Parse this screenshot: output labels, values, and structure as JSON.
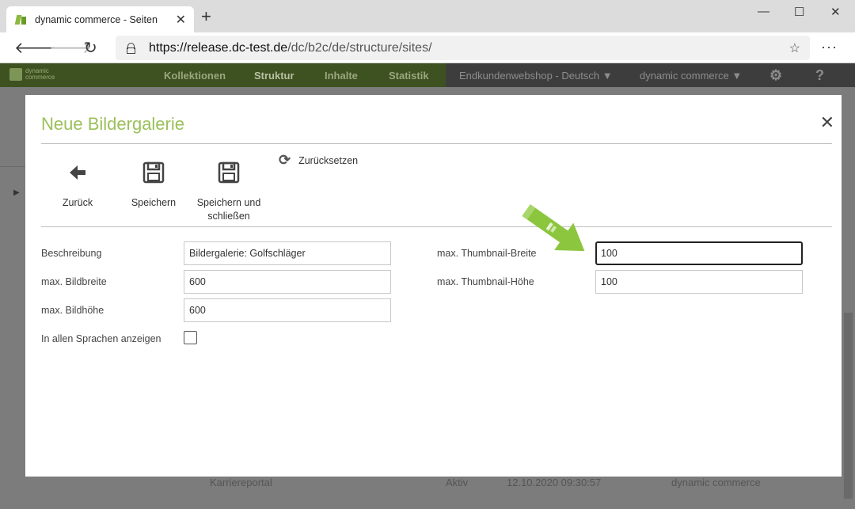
{
  "browser": {
    "tab_title": "dynamic commerce - Seiten",
    "tab_close": "✕",
    "new_tab": "+",
    "url_host": "https://release.dc-test.de",
    "url_path": "/dc/b2c/de/structure/sites/",
    "window_controls": {
      "minimize": "—",
      "maximize": "☐",
      "close": "✕"
    }
  },
  "app_header": {
    "logo_line1": "dynamic",
    "logo_line2": "commerce",
    "nav": [
      "Kollektionen",
      "Struktur",
      "Inhalte",
      "Statistik"
    ],
    "shop_select": "Endkundenwebshop - Deutsch",
    "company_select": "dynamic commerce",
    "settings_icon": "gear-icon",
    "help_label": "?"
  },
  "background_row": {
    "name": "Karriereportal",
    "status": "Aktiv",
    "date": "12.10.2020 09:30:57",
    "owner": "dynamic commerce"
  },
  "modal": {
    "title": "Neue Bildergalerie",
    "toolbar": {
      "back_label": "Zurück",
      "save_label": "Speichern",
      "save_close_label_line1": "Speichern und",
      "save_close_label_line2": "schließen",
      "reset_label": "Zurücksetzen"
    },
    "fields": {
      "beschreibung_label": "Beschreibung",
      "beschreibung_value": "Bildergalerie: Golfschläger",
      "bildbreite_label": "max. Bildbreite",
      "bildbreite_value": "600",
      "bildhoehe_label": "max. Bildhöhe",
      "bildhoehe_value": "600",
      "sprachen_label": "In allen Sprachen anzeigen",
      "sprachen_checked": false,
      "thumb_breite_label": "max. Thumbnail-Breite",
      "thumb_breite_value": "100",
      "thumb_hoehe_label": "max. Thumbnail-Höhe",
      "thumb_hoehe_value": "100"
    }
  },
  "colors": {
    "accent_green": "#9bc05a",
    "arrow_green": "#8cc63f"
  }
}
